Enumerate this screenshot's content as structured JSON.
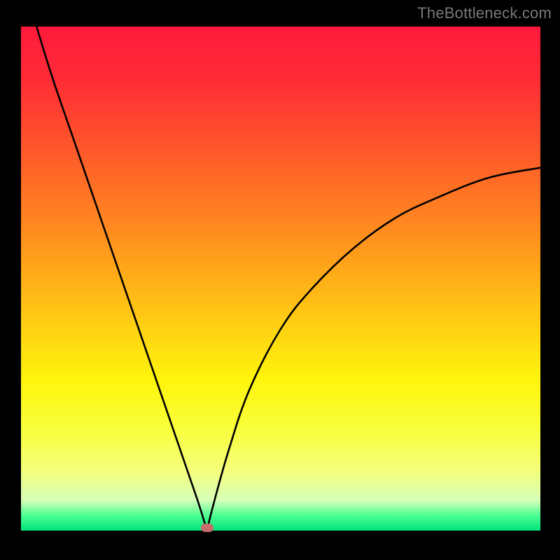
{
  "watermark": "TheBottleneck.com",
  "chart_data": {
    "type": "line",
    "title": "",
    "xlabel": "",
    "ylabel": "",
    "xlim": [
      0,
      100
    ],
    "ylim": [
      0,
      100
    ],
    "series": [
      {
        "name": "bottleneck-curve",
        "x": [
          3,
          6,
          10,
          14,
          18,
          22,
          26,
          30,
          34,
          35.8,
          37,
          40,
          44,
          50,
          56,
          64,
          72,
          80,
          90,
          100
        ],
        "values": [
          100,
          90,
          78,
          66,
          54,
          42,
          30,
          18,
          6,
          0,
          5,
          16,
          28,
          40,
          48,
          56,
          62,
          66,
          70,
          72
        ]
      }
    ],
    "marker": {
      "x": 35.8,
      "y": 0.5
    },
    "gradient_stops": [
      {
        "pos": 0,
        "color": "#ff1a3c"
      },
      {
        "pos": 50,
        "color": "#ffd212"
      },
      {
        "pos": 88,
        "color": "#f5ff7a"
      },
      {
        "pos": 100,
        "color": "#00e37a"
      }
    ],
    "grid": false,
    "legend": false
  }
}
